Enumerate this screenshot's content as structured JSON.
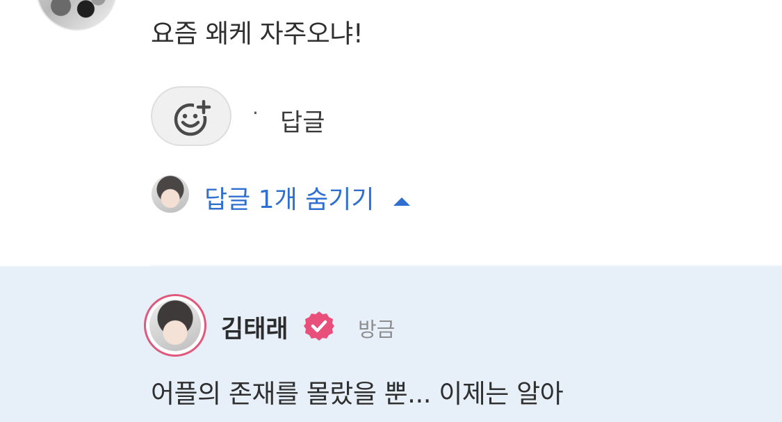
{
  "comment": {
    "text": "요즘 왜케 자주오냐!",
    "reply_dot": "·",
    "reply_label": "답글",
    "add_reaction_icon": "smiley-plus-icon"
  },
  "replies_toggle": {
    "label": "답글 1개 숨기기",
    "icon": "caret-up-icon",
    "color": "#2f6fd0"
  },
  "reply": {
    "author": "김태래",
    "verified_icon": "verified-badge-icon",
    "verified_color": "#e94f7b",
    "time": "방금",
    "text": "어플의 존재를 몰랐을 뿐... 이제는 알아",
    "background_color": "#e7eff9",
    "avatar_ring_color": "#e0587c"
  }
}
